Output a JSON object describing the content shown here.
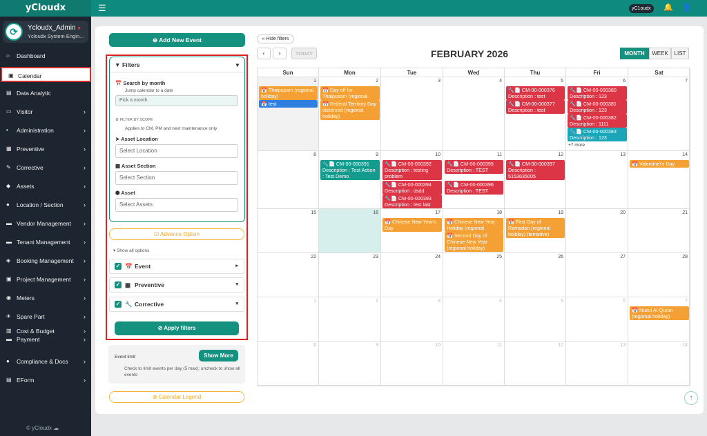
{
  "app": {
    "brand": "yCloudx",
    "chip": "yC1oudx",
    "footer": "© yCloudx"
  },
  "user": {
    "name": "Ycloudx_Admin",
    "role": "Ycloudx System Engin..."
  },
  "nav": [
    {
      "label": "Dashboard",
      "icon": "dashboard-icon",
      "arrow": false
    },
    {
      "label": "Calendar",
      "icon": "calendar-icon",
      "arrow": false,
      "active": true
    },
    {
      "label": "Data Analytic",
      "icon": "chart-icon",
      "arrow": false
    },
    {
      "label": "Visitor",
      "icon": "id-card-icon",
      "arrow": true
    },
    {
      "label": "Administration",
      "icon": "admin-icon",
      "arrow": true
    },
    {
      "label": "Preventive",
      "icon": "calendar-grid-icon",
      "arrow": true
    },
    {
      "label": "Corrective",
      "icon": "wrench-icon",
      "arrow": true
    },
    {
      "label": "Assets",
      "icon": "tag-icon",
      "arrow": true
    },
    {
      "label": "Location / Section",
      "icon": "location-icon",
      "arrow": true
    },
    {
      "label": "Vendor Management",
      "icon": "vendor-icon",
      "arrow": true
    },
    {
      "label": "Tenant Management",
      "icon": "tenant-icon",
      "arrow": true
    },
    {
      "label": "Booking Management",
      "icon": "booking-icon",
      "arrow": true
    },
    {
      "label": "Project Management",
      "icon": "project-icon",
      "arrow": true
    },
    {
      "label": "Meters",
      "icon": "meter-icon",
      "arrow": true
    },
    {
      "label": "Spare Part",
      "icon": "spare-part-icon",
      "arrow": true
    },
    {
      "label": "Cost & Budget",
      "icon": "budget-icon",
      "arrow": true
    },
    {
      "label": "Payment",
      "icon": "payment-icon",
      "arrow": true
    },
    {
      "label": "Compliance & Docs",
      "icon": "compliance-icon",
      "arrow": true
    },
    {
      "label": "EForm",
      "icon": "form-icon",
      "arrow": true
    }
  ],
  "left": {
    "add_event": "Add New Event",
    "filters": "Filters",
    "search_by_month": "Search by month",
    "jump_hint": "Jump calendar to a date",
    "month_placeholder": "Pick a month",
    "filter_by_scope": "FILTER BY SCOPE",
    "scope_hint": "Applies to CM, PM and next maintenance only",
    "asset_location": "Asset Location",
    "asset_location_ph": "Select Location",
    "asset_section": "Asset Section",
    "asset_section_ph": "Select Section",
    "asset": "Asset",
    "asset_ph": "Select Assets",
    "advance_option": "Advance Option",
    "show_all": "Show all options",
    "event": "Event",
    "preventive": "Preventive",
    "corrective": "Corrective",
    "apply": "Apply filters",
    "event_limit": "Event limit",
    "show_more": "Show More",
    "limit_hint": "Check to limit events per day (5 max); uncheck to show all events",
    "legend": "Calendar Legend"
  },
  "calendar": {
    "hide_filters": "Hide filters",
    "today": "TODAY",
    "title": "FEBRUARY 2026",
    "views": [
      "MONTH",
      "WEEK",
      "LIST"
    ],
    "days": [
      "Sun",
      "Mon",
      "Tue",
      "Wed",
      "Thu",
      "Fri",
      "Sat"
    ],
    "weeks": [
      [
        {
          "d": "1"
        },
        {
          "d": "2"
        },
        {
          "d": "3"
        },
        {
          "d": "4"
        },
        {
          "d": "5"
        },
        {
          "d": "6"
        },
        {
          "d": "7"
        }
      ],
      [
        {
          "d": "8"
        },
        {
          "d": "9"
        },
        {
          "d": "10"
        },
        {
          "d": "11"
        },
        {
          "d": "12"
        },
        {
          "d": "13"
        },
        {
          "d": "14"
        }
      ],
      [
        {
          "d": "15"
        },
        {
          "d": "16"
        },
        {
          "d": "17"
        },
        {
          "d": "18"
        },
        {
          "d": "19"
        },
        {
          "d": "20"
        },
        {
          "d": "21"
        }
      ],
      [
        {
          "d": "22"
        },
        {
          "d": "23"
        },
        {
          "d": "24"
        },
        {
          "d": "25"
        },
        {
          "d": "26"
        },
        {
          "d": "27"
        },
        {
          "d": "28"
        }
      ],
      [
        {
          "d": "1",
          "o": true
        },
        {
          "d": "2",
          "o": true
        },
        {
          "d": "3",
          "o": true
        },
        {
          "d": "4",
          "o": true
        },
        {
          "d": "5",
          "o": true
        },
        {
          "d": "6",
          "o": true
        },
        {
          "d": "7",
          "o": true
        }
      ],
      [
        {
          "d": "8",
          "o": true
        },
        {
          "d": "9",
          "o": true
        },
        {
          "d": "10",
          "o": true
        },
        {
          "d": "11",
          "o": true
        },
        {
          "d": "12",
          "o": true
        },
        {
          "d": "13",
          "o": true
        },
        {
          "d": "14",
          "o": true
        }
      ]
    ],
    "events": [
      {
        "w": 0,
        "c": 0,
        "slot": 0,
        "rows": 2,
        "color": "o",
        "text": "📅 Thaipusam (regional holiday)"
      },
      {
        "w": 0,
        "c": 0,
        "slot": 2,
        "rows": 1,
        "color": "b",
        "text": "📅 test"
      },
      {
        "w": 0,
        "c": 1,
        "slot": 0,
        "rows": 2,
        "color": "o",
        "text": "📅 Day off for Thaipusam (regional holiday)"
      },
      {
        "w": 0,
        "c": 1,
        "slot": 2,
        "rows": 3,
        "color": "o",
        "text": "📅 Federal Territory Day observed (regional holiday)"
      },
      {
        "w": 0,
        "c": 4,
        "slot": 0,
        "rows": 2,
        "color": "r",
        "text": "🔧📄 CM-00-000376 Description : test"
      },
      {
        "w": 0,
        "c": 4,
        "slot": 2,
        "rows": 2,
        "color": "r",
        "text": "🔧📄 CM-00-000377 Description : test"
      },
      {
        "w": 0,
        "c": 5,
        "slot": 0,
        "rows": 2,
        "color": "r",
        "text": "🔧📄 CM-00-000380 Description : 123"
      },
      {
        "w": 0,
        "c": 5,
        "slot": 2,
        "rows": 2,
        "color": "r",
        "text": "🔧📄 CM-00-000381 Description : 123"
      },
      {
        "w": 0,
        "c": 5,
        "slot": 4,
        "rows": 2,
        "color": "r",
        "text": "🔧📄 CM-00-000382 Description : 1111"
      },
      {
        "w": 0,
        "c": 5,
        "slot": 6,
        "rows": 2,
        "color": "c",
        "text": "🔧📄 CM-00-000383 Description : 123"
      },
      {
        "w": 1,
        "c": 1,
        "slot": 0,
        "rows": 3,
        "color": "t",
        "text": "🔧📄 CM-00-000391 Description : Test Action : Test Demo"
      },
      {
        "w": 1,
        "c": 2,
        "slot": 0,
        "rows": 3,
        "color": "r",
        "text": "🔧📄 CM-00-000392 Description : testing problem"
      },
      {
        "w": 1,
        "c": 2,
        "slot": 3,
        "rows": 2,
        "color": "r",
        "text": "🔧📄 CM-00-000394 Description : dsdd"
      },
      {
        "w": 1,
        "c": 2,
        "slot": 5,
        "rows": 2,
        "color": "r",
        "text": "🔧📄 CM-00-000393 Description : test last"
      },
      {
        "w": 1,
        "c": 3,
        "slot": 0,
        "rows": 2,
        "color": "r",
        "text": "🔧📄 CM-00-000395 Description : TEST"
      },
      {
        "w": 1,
        "c": 3,
        "slot": 3,
        "rows": 2,
        "color": "r",
        "text": "🔧📄 CM-00-000396 Description : TEST"
      },
      {
        "w": 1,
        "c": 4,
        "slot": 0,
        "rows": 3,
        "color": "r",
        "text": "🔧📄 CM-00-000397 Description : 5153635005"
      },
      {
        "w": 1,
        "c": 6,
        "slot": 0,
        "rows": 1,
        "color": "o",
        "text": "📅 Valentine\\'s Day"
      },
      {
        "w": 2,
        "c": 2,
        "slot": 0,
        "rows": 2,
        "color": "o",
        "text": "📅 Chinese New Year's Day"
      },
      {
        "w": 2,
        "c": 3,
        "slot": 0,
        "rows": 2,
        "color": "o",
        "text": "📅 Chinese New Year Holiday (regional holiday)"
      },
      {
        "w": 2,
        "c": 3,
        "slot": 2,
        "rows": 3,
        "color": "o",
        "text": "📅 Second Day of Chinese New Year (regional holiday)"
      },
      {
        "w": 2,
        "c": 4,
        "slot": 0,
        "rows": 3,
        "color": "o",
        "text": "📅 First Day of Ramadan (regional holiday) (tentative)"
      },
      {
        "w": 4,
        "c": 6,
        "slot": 0,
        "rows": 2,
        "color": "o",
        "text": "📅 Nuzul Al-Quran (regional holiday)"
      }
    ],
    "more": {
      "w": 0,
      "c": 5,
      "text": "+7 more"
    },
    "highlight": {
      "w": 2,
      "c": 1
    }
  }
}
